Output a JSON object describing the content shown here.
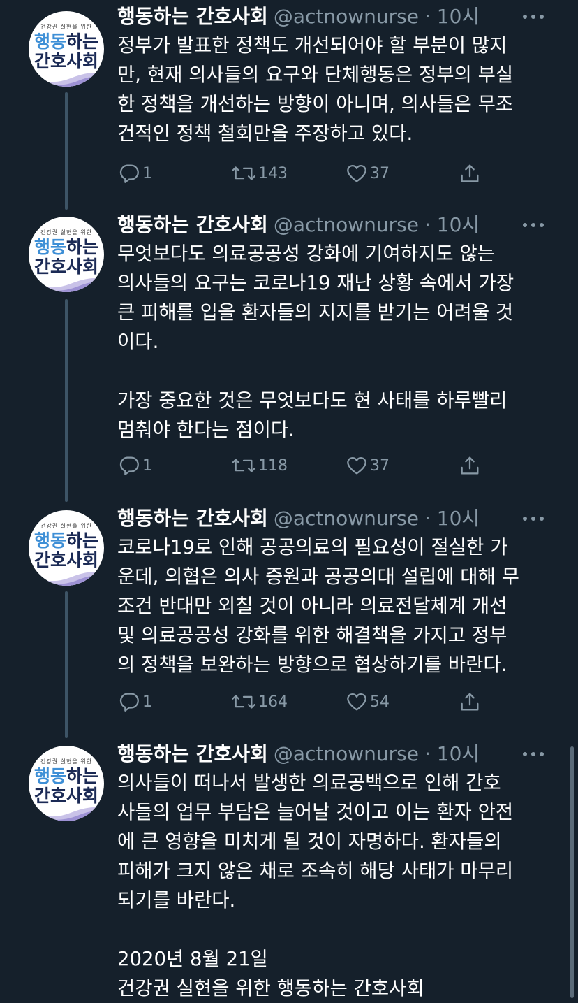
{
  "tweets": [
    {
      "name": "행동하는 간호사회",
      "handle": "@actnownurse",
      "time": "· 10시",
      "text": "정부가 발표한 정책도 개선되어야 할 부분이 많지\n만, 현재 의사들의 요구와 단체행동은 정부의 부실\n한 정책을 개선하는 방향이 아니며, 의사들은 무조\n건적인 정책 철회만을 주장하고 있다.",
      "replies": "1",
      "retweets": "143",
      "likes": "37"
    },
    {
      "name": "행동하는 간호사회",
      "handle": "@actnownurse",
      "time": "· 10시",
      "text": "무엇보다도 의료공공성 강화에 기여하지도 않는\n의사들의 요구는 코로나19 재난 상황 속에서 가장\n큰 피해를 입을 환자들의 지지를 받기는 어려울 것\n이다.\n\n가장 중요한 것은 무엇보다도 현 사태를 하루빨리\n멈춰야 한다는 점이다.",
      "replies": "1",
      "retweets": "118",
      "likes": "37"
    },
    {
      "name": "행동하는 간호사회",
      "handle": "@actnownurse",
      "time": "· 10시",
      "text": "코로나19로 인해 공공의료의 필요성이 절실한 가\n운데, 의협은 의사 증원과 공공의대 설립에 대해 무\n조건 반대만 외칠 것이 아니라 의료전달체계 개선\n및 의료공공성 강화를 위한 해결책을 가지고 정부\n의 정책을 보완하는 방향으로 협상하기를 바란다.",
      "replies": "1",
      "retweets": "164",
      "likes": "54"
    },
    {
      "name": "행동하는 간호사회",
      "handle": "@actnownurse",
      "time": "· 10시",
      "text": "의사들이 떠나서 발생한 의료공백으로 인해 간호\n사들의 업무 부담은 늘어날 것이고 이는 환자 안전\n에 큰 영향을 미치게 될 것이 자명하다. 환자들의\n피해가 크지 않은 채로 조속히 해당 사태가 마무리\n되기를 바란다.\n\n2020년 8월 21일\n건강권 실현을 위한 행동하는 간호사회"
    }
  ],
  "avatar": {
    "tagline": "건강권 실현을 위한",
    "line1_a": "행동",
    "line1_b": "하는",
    "line2": "간호사회"
  },
  "colors": {
    "background": "#15202b",
    "secondary_text": "#8899a6",
    "thread_line": "#3d5466"
  },
  "icons": [
    "reply-icon",
    "retweet-icon",
    "like-icon",
    "share-icon",
    "more-icon"
  ]
}
